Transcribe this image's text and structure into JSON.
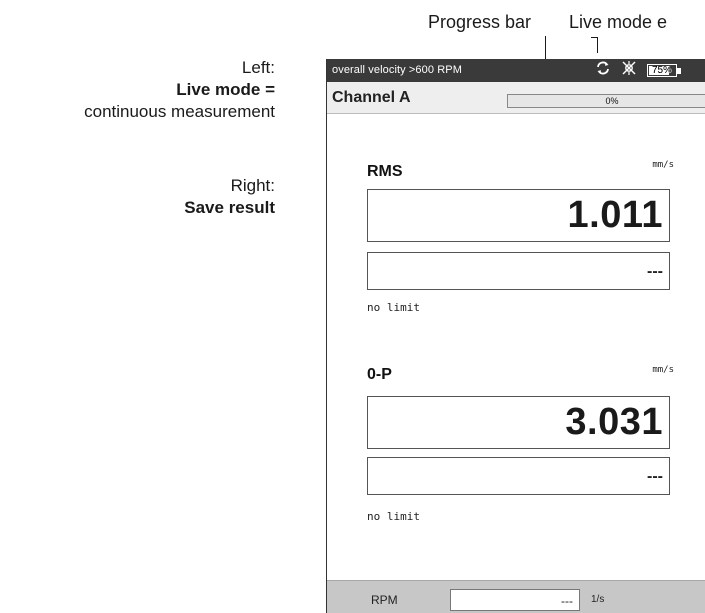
{
  "annotations": {
    "left_heading": "Left:",
    "left_bold": "Live mode =",
    "left_desc": "continuous measurement",
    "right_heading": "Right:",
    "right_bold": "Save result",
    "callout_progress": "Progress bar",
    "callout_live": "Live mode e"
  },
  "status_bar": {
    "title": "overall velocity >600 RPM",
    "icons": [
      "refresh-icon",
      "sensor-icon",
      "battery-icon"
    ],
    "battery_percent": "75%",
    "battery_level": 0.75
  },
  "channel": {
    "label": "Channel A",
    "progress_text": "0%",
    "progress_value": 0
  },
  "measurements": [
    {
      "title": "RMS",
      "unit": "mm/s",
      "value": "1.011",
      "limit_value": "---",
      "limit_text": "no limit"
    },
    {
      "title": "0-P",
      "unit": "mm/s",
      "value": "3.031",
      "limit_value": "---",
      "limit_text": "no limit"
    }
  ],
  "rpm": {
    "label": "RPM",
    "value": "---",
    "unit": "1/s"
  },
  "colors": {
    "statusbar": "#3a3a3a",
    "rpm_bar": "#c7c7c7",
    "progress_track": "#e6e6e6"
  }
}
